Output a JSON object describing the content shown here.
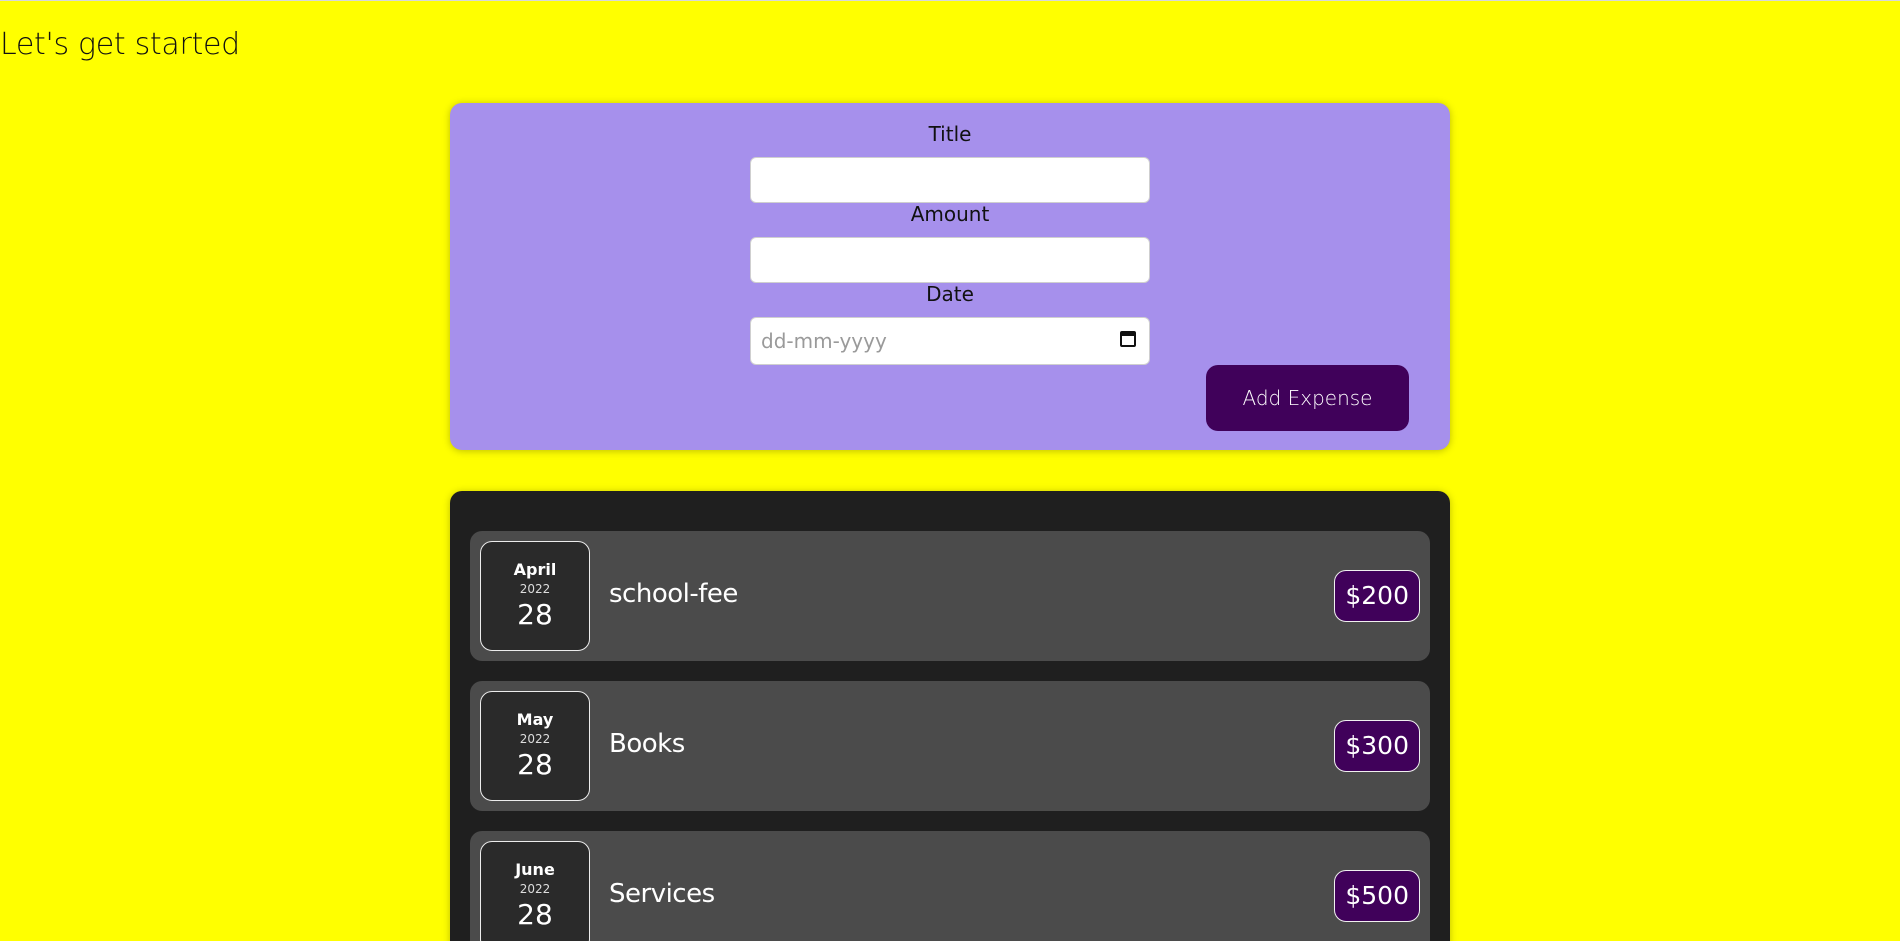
{
  "page": {
    "heading": "Let's get started"
  },
  "form": {
    "title_label": "Title",
    "title_value": "",
    "amount_label": "Amount",
    "amount_value": "",
    "date_label": "Date",
    "date_placeholder": "dd-mm-yyyy",
    "add_button_label": "Add Expense"
  },
  "expenses": [
    {
      "month": "April",
      "year": "2022",
      "day": "28",
      "title": "school-fee",
      "amount": "$200"
    },
    {
      "month": "May",
      "year": "2022",
      "day": "28",
      "title": "Books",
      "amount": "$300"
    },
    {
      "month": "June",
      "year": "2022",
      "day": "28",
      "title": "Services",
      "amount": "$500"
    }
  ],
  "colors": {
    "page_background": "#ffff00",
    "form_background": "#a690ec",
    "button_background": "#40015a",
    "list_background": "#1f1f1f",
    "item_background": "#4b4b4b"
  },
  "icons": {
    "date_picker": "calendar-icon"
  }
}
